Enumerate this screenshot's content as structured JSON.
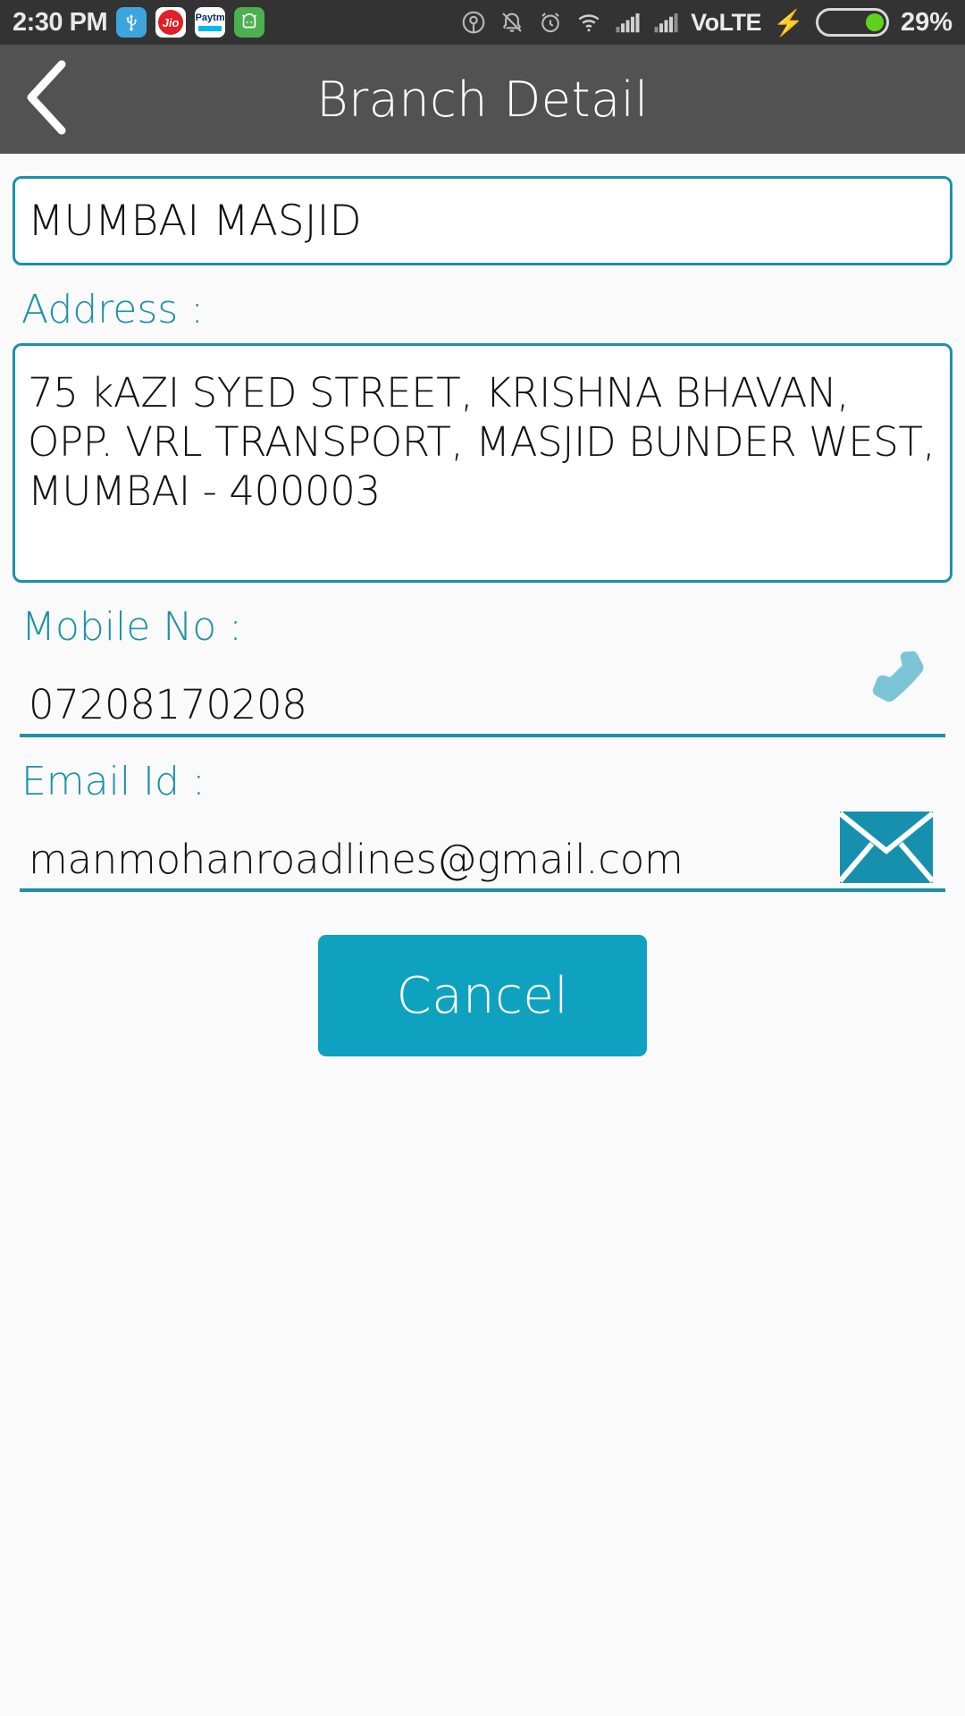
{
  "status_bar": {
    "time": "2:30 PM",
    "app_icons": [
      {
        "name": "usb-icon",
        "glyph": "Ψ"
      },
      {
        "name": "jio-icon",
        "glyph": "Jio"
      },
      {
        "name": "paytm-icon",
        "glyph": "Paytm"
      },
      {
        "name": "green-app-icon",
        "glyph": "◎"
      }
    ],
    "icons": [
      "location-icon",
      "notifications-off-icon",
      "alarm-icon",
      "wifi-icon",
      "signal-sim1-icon",
      "signal-sim2-icon"
    ],
    "volte_label": "VoLTE",
    "charging": true,
    "battery_percent": "29%",
    "battery_level": 29,
    "background": "#333333"
  },
  "header": {
    "title": "Branch Detail",
    "back_icon": "back-chevron-icon",
    "background": "#525252"
  },
  "theme": {
    "accent": "#1a92a8",
    "button": "#0fa2c0",
    "phone_icon_color": "#7cc5d8",
    "mail_icon_color": "#1690ad",
    "page_background": "#fafafa"
  },
  "form": {
    "branch_name": {
      "value": "MUMBAI MASJID"
    },
    "address": {
      "label": "Address :",
      "value": "75 kAZI SYED STREET, KRISHNA BHAVAN, OPP. VRL TRANSPORT, MASJID BUNDER WEST, MUMBAI - 400003"
    },
    "mobile": {
      "label": "Mobile No :",
      "value": "07208170208",
      "action_icon": "phone-call-icon"
    },
    "email": {
      "label": "Email Id :",
      "value": "manmohanroadlines@gmail.com",
      "action_icon": "envelope-icon"
    },
    "cancel_label": "Cancel"
  }
}
